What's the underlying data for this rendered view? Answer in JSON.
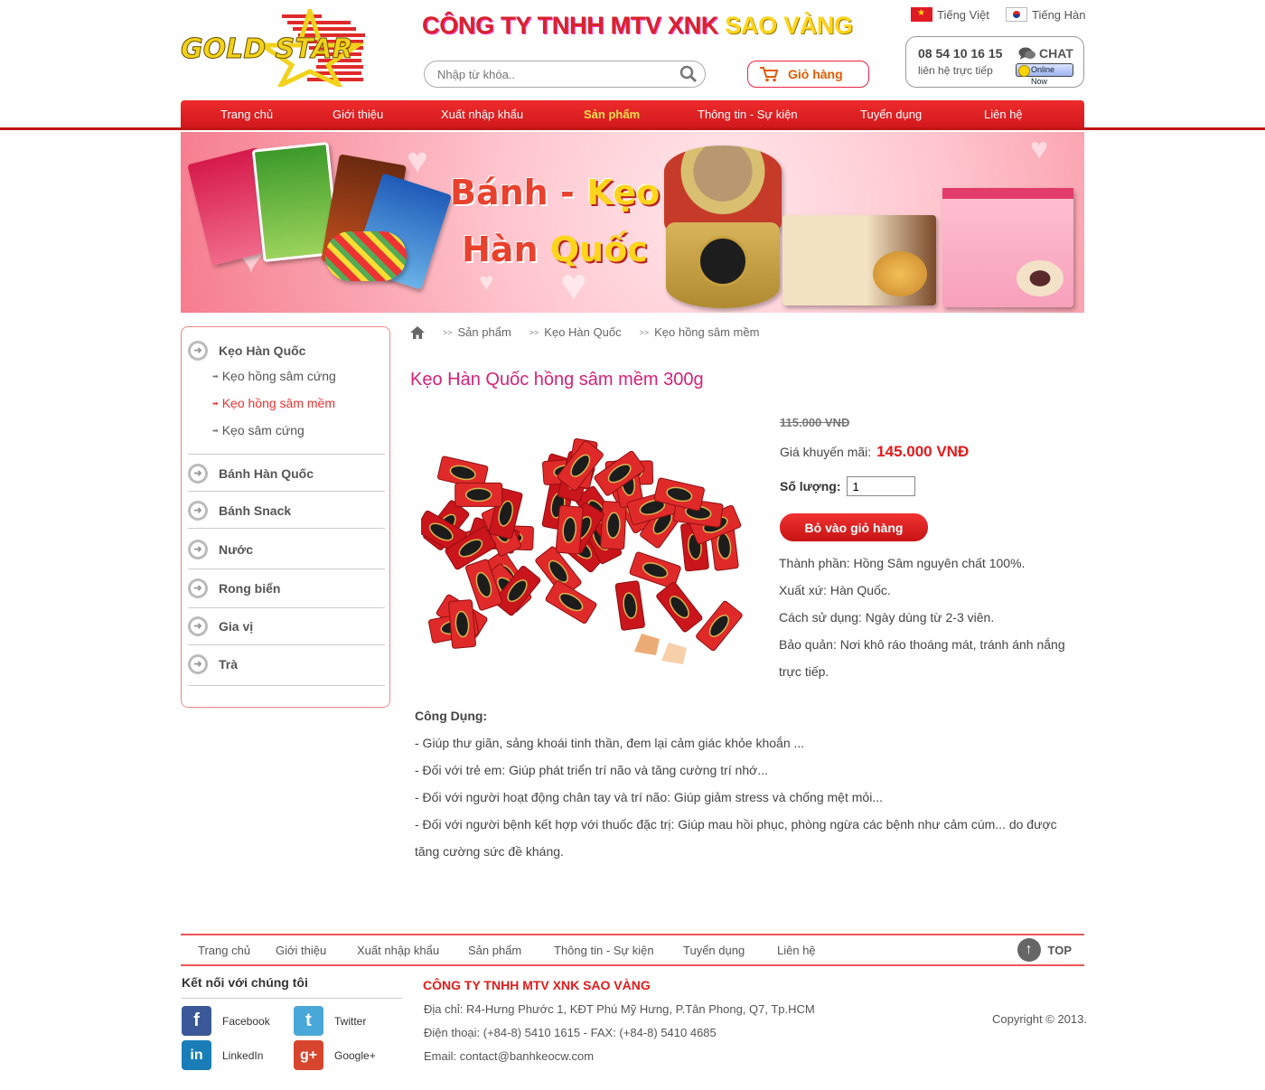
{
  "header": {
    "logo_text": "GOLD STAR",
    "company_prefix": "CÔNG TY TNHH MTV XNK",
    "company_highlight": "SAO VÀNG",
    "languages": [
      {
        "label": "Tiếng Việt",
        "flag": "vietnam-flag-icon"
      },
      {
        "label": "Tiếng Hàn",
        "flag": "korea-flag-icon"
      }
    ],
    "search_placeholder": "Nhập từ khóa..",
    "cart_label": "Giỏ hàng",
    "phone": "08 54 10 16 15",
    "phone_sub": "liên hệ trực tiếp",
    "chat_label": "CHAT",
    "online_label": "Online Now"
  },
  "nav": {
    "items": [
      {
        "label": "Trang chủ"
      },
      {
        "label": "Giới thiệu"
      },
      {
        "label": "Xuất nhập khẩu"
      },
      {
        "label": "Sản phẩm",
        "active": true
      },
      {
        "label": "Thông tin - Sự kiện"
      },
      {
        "label": "Tuyển dụng"
      },
      {
        "label": "Liên hệ"
      }
    ]
  },
  "banner": {
    "line1_a": "Bánh",
    "line1_sep": " - ",
    "line1_b": "Kẹo",
    "line2_a": "Hàn ",
    "line2_b": "Quốc"
  },
  "sidebar": {
    "categories": [
      {
        "label": "Kẹo Hàn Quốc",
        "subs": [
          {
            "label": "Kẹo hồng sâm cứng"
          },
          {
            "label": "Kẹo hồng sâm mềm",
            "active": true
          },
          {
            "label": "Kẹo sâm cứng"
          }
        ]
      },
      {
        "label": "Bánh Hàn Quốc"
      },
      {
        "label": "Bánh Snack"
      },
      {
        "label": "Nước"
      },
      {
        "label": "Rong biển"
      },
      {
        "label": "Gia vị"
      },
      {
        "label": "Trà"
      }
    ]
  },
  "breadcrumb": [
    "Sản phẩm",
    "Kẹo Hàn Quốc",
    "Kẹo hồng sâm mềm"
  ],
  "product": {
    "title": "Kẹo Hàn Quốc hồng sâm mềm 300g",
    "old_price": "115.000 VNĐ",
    "promo_label": "Giá khuyến mãi:",
    "promo_price": "145.000 VNĐ",
    "qty_label": "Số lượng:",
    "qty_value": "1",
    "add_to_cart": "Bỏ vào giỏ hàng",
    "specs": [
      "Thành phần: Hồng Sâm nguyên chất 100%.",
      "Xuất xứ: Hàn Quốc.",
      "Cách sử dụng: Ngày dùng từ 2-3 viên.",
      "Bảo quản: Nơi khô ráo thoáng mát, tránh ánh nắng trực tiếp."
    ],
    "usage_title": "Công Dụng:",
    "usage": [
      "-  Giúp thư giãn, sảng khoái tinh thần, đem lại cảm giác khỏe khoắn ...",
      "-  Đối với trẻ em: Giúp phát triển trí não và tăng cường trí nhớ...",
      "-  Đối với người hoạt động chân tay và trí não: Giúp giảm stress và chống mệt mỏi...",
      "-  Đối với người bệnh kết hợp với thuốc đặc trị: Giúp mau hồi phục, phòng ngừa các bệnh như cảm cúm... do được tăng cường sức đề kháng."
    ]
  },
  "footer": {
    "nav": [
      "Trang chủ",
      "Giới thiệu",
      "Xuất nhập khẩu",
      "Sản phẩm",
      "Thông tin - Sự kiện",
      "Tuyển dụng",
      "Liên hệ"
    ],
    "top_label": "TOP",
    "connect_title": "Kết nối với chúng tôi",
    "social": [
      {
        "label": "Facebook",
        "icon": "facebook-icon",
        "glyph": "f",
        "color": "#3b5998"
      },
      {
        "label": "Twitter",
        "icon": "twitter-icon",
        "glyph": "t",
        "color": "#4aa8d8"
      },
      {
        "label": "LinkedIn",
        "icon": "linkedin-icon",
        "glyph": "in",
        "color": "#1a7db8"
      },
      {
        "label": "Google+",
        "icon": "google-plus-icon",
        "glyph": "g+",
        "color": "#d8452e"
      }
    ],
    "company": "CÔNG TY TNHH MTV XNK SAO VÀNG",
    "address": "Địa chỉ: R4-Hưng Phước 1, KĐT Phú Mỹ Hưng, P.Tân Phong, Q7, Tp.HCM",
    "phone": "Điện thoại: (+84-8) 5410 1615  -  FAX: (+84-8) 5410 4685",
    "email": "Email: contact@banhkeocw.com",
    "copyright": "Copyright © 2013."
  }
}
